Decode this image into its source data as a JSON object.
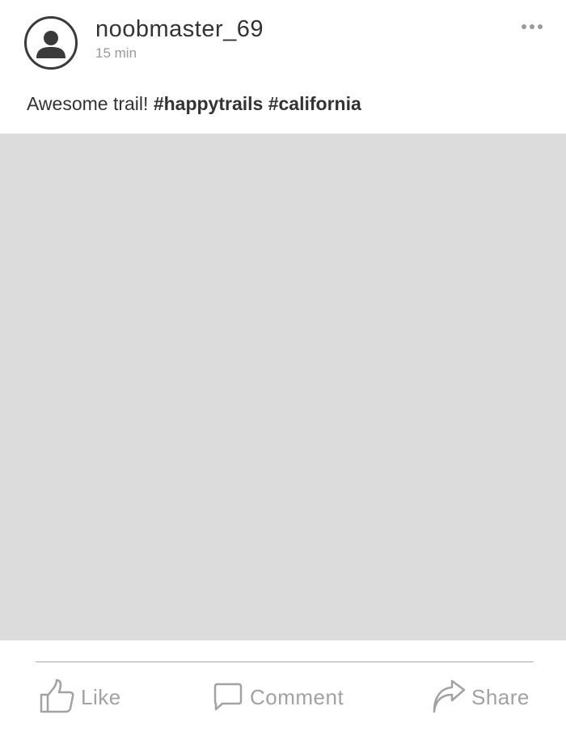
{
  "post": {
    "author": "noobmaster_69",
    "time": "15 min",
    "caption_text": "Awesome trail! ",
    "hashtags": [
      "#happytrails",
      "#california"
    ]
  },
  "actions": {
    "like_label": "Like",
    "comment_label": "Comment",
    "share_label": "Share"
  },
  "icons": {
    "avatar": "user-avatar-icon",
    "more": "more-options-icon",
    "like": "thumbs-up-icon",
    "comment": "comment-bubble-icon",
    "share": "share-arrow-icon"
  },
  "colors": {
    "text": "#333333",
    "muted": "#9a9a9a",
    "photo_placeholder": "#dcdcdc",
    "action_gray": "#a2a2a2"
  }
}
